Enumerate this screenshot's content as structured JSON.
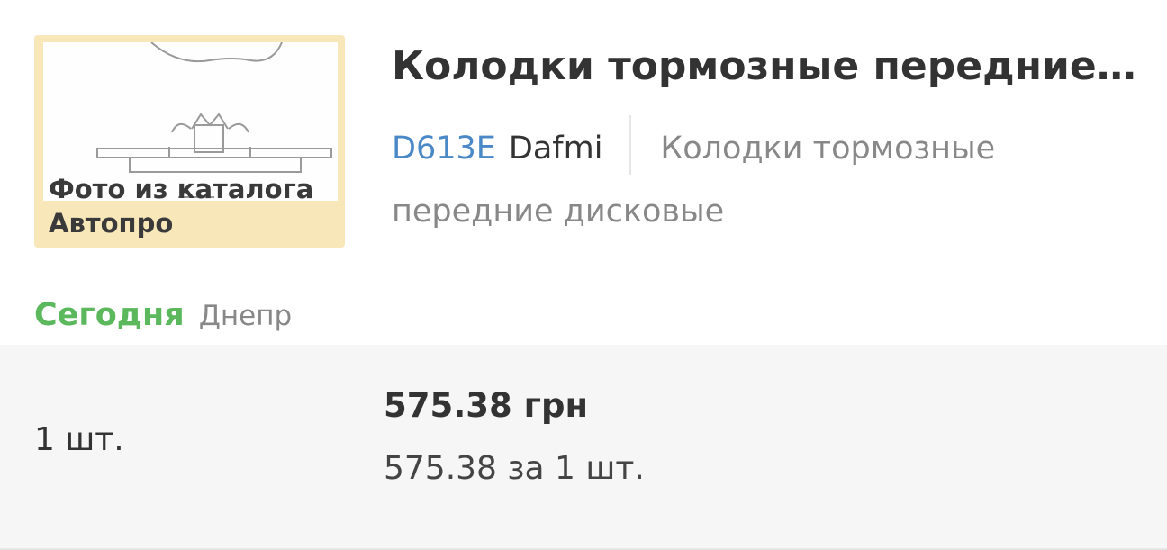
{
  "product": {
    "image_caption": "Фото из каталога Автопро",
    "title": "Колодки тормозные передние…",
    "code": "D613E",
    "brand": "Dafmi",
    "description": "Колодки тормозные передние дисковые"
  },
  "availability": {
    "when": "Сегодня",
    "city": "Днепр"
  },
  "pricing": {
    "quantity": "1 шт.",
    "total": "575.38 грн",
    "per_unit": "575.38 за 1 шт."
  },
  "colors": {
    "code_link": "#4a88c7",
    "today_green": "#5cb85c",
    "image_bg": "#f7e7b9"
  }
}
